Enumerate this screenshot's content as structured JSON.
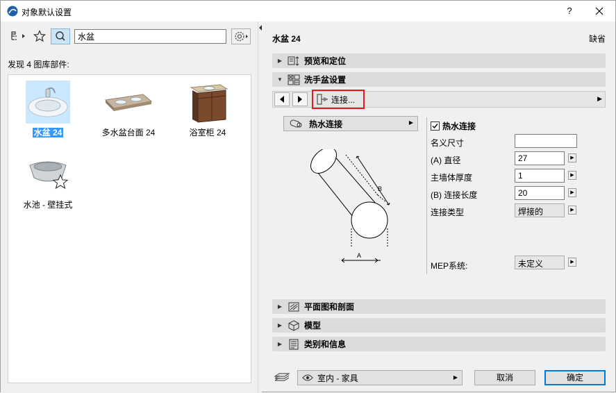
{
  "window": {
    "title": "对象默认设置",
    "help": "?",
    "close": "✕"
  },
  "left": {
    "search": {
      "value": "水盆"
    },
    "found_label": "发现 4 图库部件:",
    "items": [
      {
        "label": "水盆 24"
      },
      {
        "label": "多水盆台面 24"
      },
      {
        "label": "浴室柜 24"
      },
      {
        "label": "水池 - 壁挂式"
      }
    ]
  },
  "right": {
    "object_name": "水盆 24",
    "default_label": "缺省",
    "sections": {
      "preview": "预览和定位",
      "sink_settings": "洗手盆设置",
      "plan": "平面图和剖面",
      "model": "模型",
      "category": "类别和信息"
    },
    "nav": {
      "connection": "连接..."
    },
    "hot_water_button": "热水连接",
    "diagram": {
      "label_a": "A",
      "label_b": "B"
    },
    "params": {
      "hot_water_check": "热水连接",
      "nominal_size": {
        "label": "名义尺寸",
        "value": ""
      },
      "diameter": {
        "label": "(A) 直径",
        "value": "27"
      },
      "wall_thickness": {
        "label": "主墙体厚度",
        "value": "1"
      },
      "conn_length": {
        "label": "(B) 连接长度",
        "value": "20"
      },
      "conn_type": {
        "label": "连接类型",
        "value": "焊接的"
      },
      "mep_system": {
        "label": "MEP系统:",
        "value": "未定义"
      }
    }
  },
  "footer": {
    "layer": "室内 - 家具",
    "cancel": "取消",
    "ok": "确定"
  },
  "colors": {
    "highlight": "#e31b1b",
    "selection": "#3399ff",
    "primary_border": "#0078d7"
  }
}
